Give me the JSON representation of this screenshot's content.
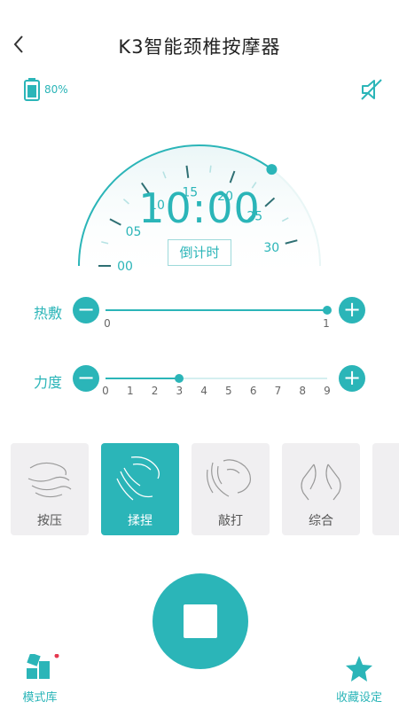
{
  "header": {
    "title": "K3智能颈椎按摩器",
    "back_icon": "chevron-left-icon"
  },
  "status": {
    "battery_percent": "80%",
    "mute_icon": "speaker-muted-icon"
  },
  "timer": {
    "display": "10:00",
    "countdown_label": "倒计时",
    "scale_labels": [
      "00",
      "05",
      "10",
      "15",
      "20",
      "25",
      "30"
    ],
    "current_minutes": 10,
    "indicator_minutes": 23
  },
  "heat": {
    "label": "热敷",
    "min": "0",
    "max": "1",
    "value": 1,
    "minus": "−",
    "plus": "+"
  },
  "intensity": {
    "label": "力度",
    "ticks": [
      "0",
      "1",
      "2",
      "3",
      "4",
      "5",
      "6",
      "7",
      "8",
      "9"
    ],
    "value": 3,
    "minus": "−",
    "plus": "+"
  },
  "modes": [
    {
      "label": "按压",
      "active": false
    },
    {
      "label": "揉捏",
      "active": true
    },
    {
      "label": "敲打",
      "active": false
    },
    {
      "label": "综合",
      "active": false
    }
  ],
  "bottom": {
    "mode_library": "模式库",
    "favorites": "收藏设定"
  },
  "colors": {
    "accent": "#2bb5b8",
    "card_bg": "#f0eff1",
    "badge": "#e53950"
  }
}
